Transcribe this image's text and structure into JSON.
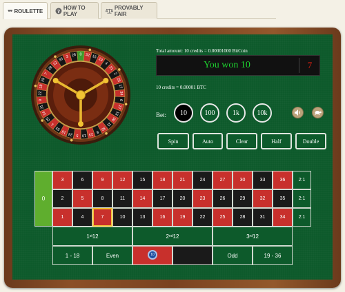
{
  "tabs": [
    {
      "label": "ROULETTE",
      "icon": "sunglasses-icon",
      "active": true
    },
    {
      "label": "HOW TO PLAY",
      "icon": "question-circle-icon",
      "active": false
    },
    {
      "label": "PROVABLY FAIR",
      "icon": "balance-scale-icon",
      "active": false
    }
  ],
  "info": {
    "total": "Total amount: 10 credits = 0.00001000 BitCoin",
    "message": "You won 10",
    "last_number": "7",
    "rate": "10 credits = 0.00001 BTC"
  },
  "bet": {
    "label": "Bet:",
    "chips": [
      "10",
      "100",
      "1k",
      "10k"
    ],
    "selected": "10"
  },
  "actions": [
    "Spin",
    "Auto",
    "Clear",
    "Half",
    "Double"
  ],
  "wheel": {
    "sequence": [
      "0",
      "32",
      "15",
      "19",
      "4",
      "21",
      "2",
      "25",
      "17",
      "34",
      "6",
      "27",
      "13",
      "36",
      "11",
      "30",
      "8",
      "23",
      "10",
      "5",
      "24",
      "16",
      "33",
      "1",
      "20",
      "14",
      "31",
      "9",
      "22",
      "18",
      "29",
      "7",
      "28",
      "12",
      "35",
      "3",
      "26"
    ],
    "ball_number": "7"
  },
  "table": {
    "zero": "0",
    "rows": [
      [
        "3",
        "6",
        "9",
        "12",
        "15",
        "18",
        "21",
        "24",
        "27",
        "30",
        "33",
        "36"
      ],
      [
        "2",
        "5",
        "8",
        "11",
        "14",
        "17",
        "20",
        "23",
        "26",
        "29",
        "32",
        "35"
      ],
      [
        "1",
        "4",
        "7",
        "10",
        "13",
        "16",
        "19",
        "22",
        "25",
        "28",
        "31",
        "34"
      ]
    ],
    "reds": [
      "1",
      "3",
      "5",
      "7",
      "9",
      "12",
      "14",
      "16",
      "18",
      "19",
      "21",
      "23",
      "25",
      "27",
      "30",
      "32",
      "34",
      "36"
    ],
    "highlight": "7",
    "columns": [
      "2:1",
      "2:1",
      "2:1"
    ],
    "dozens": [
      {
        "pre": "1",
        "sup": "st",
        "post": " 12"
      },
      {
        "pre": "2",
        "sup": "nd",
        "post": " 12"
      },
      {
        "pre": "3",
        "sup": "rd",
        "post": " 12"
      }
    ],
    "outside": [
      "1 - 18",
      "Even",
      "",
      "",
      "Odd",
      "19 - 36"
    ],
    "placed_bet": "10"
  },
  "colors": {
    "felt": "#0d5a2b",
    "red": "#c8302c",
    "black": "#1a1a1a",
    "green_zero": "#5fae2e",
    "win_text": "#1dd12f",
    "highlight": "#f2c233"
  }
}
